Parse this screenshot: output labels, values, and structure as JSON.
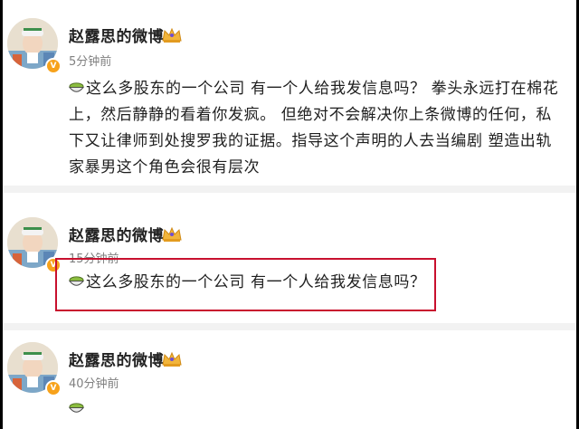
{
  "posts": [
    {
      "author": "赵露思的微博",
      "time": "5分钟前",
      "text": "这么多股东的一个公司 有一个人给我发信息吗？ 拳头永远打在棉花上，然后静静的看着你发疯。 但绝对不会解决你上条微博的任何，私下又让律师到处搜罗我的证据。指导这个声明的人去当编剧 塑造出轨家暴男这个角色会很有层次"
    },
    {
      "author": "赵露思的微博",
      "time": "15分钟前",
      "text": "这么多股东的一个公司 有一个人给我发信息吗？"
    },
    {
      "author": "赵露思的微博",
      "time": "40分钟前",
      "text": ""
    }
  ],
  "icons": {
    "verified_badge": "v-badge-icon",
    "member_crown": "crown-icon",
    "post_emoji": "green-bowl-emoji"
  },
  "colors": {
    "verified": "#f7a21b",
    "highlight_border": "#c8102e",
    "time_text": "#808080"
  }
}
